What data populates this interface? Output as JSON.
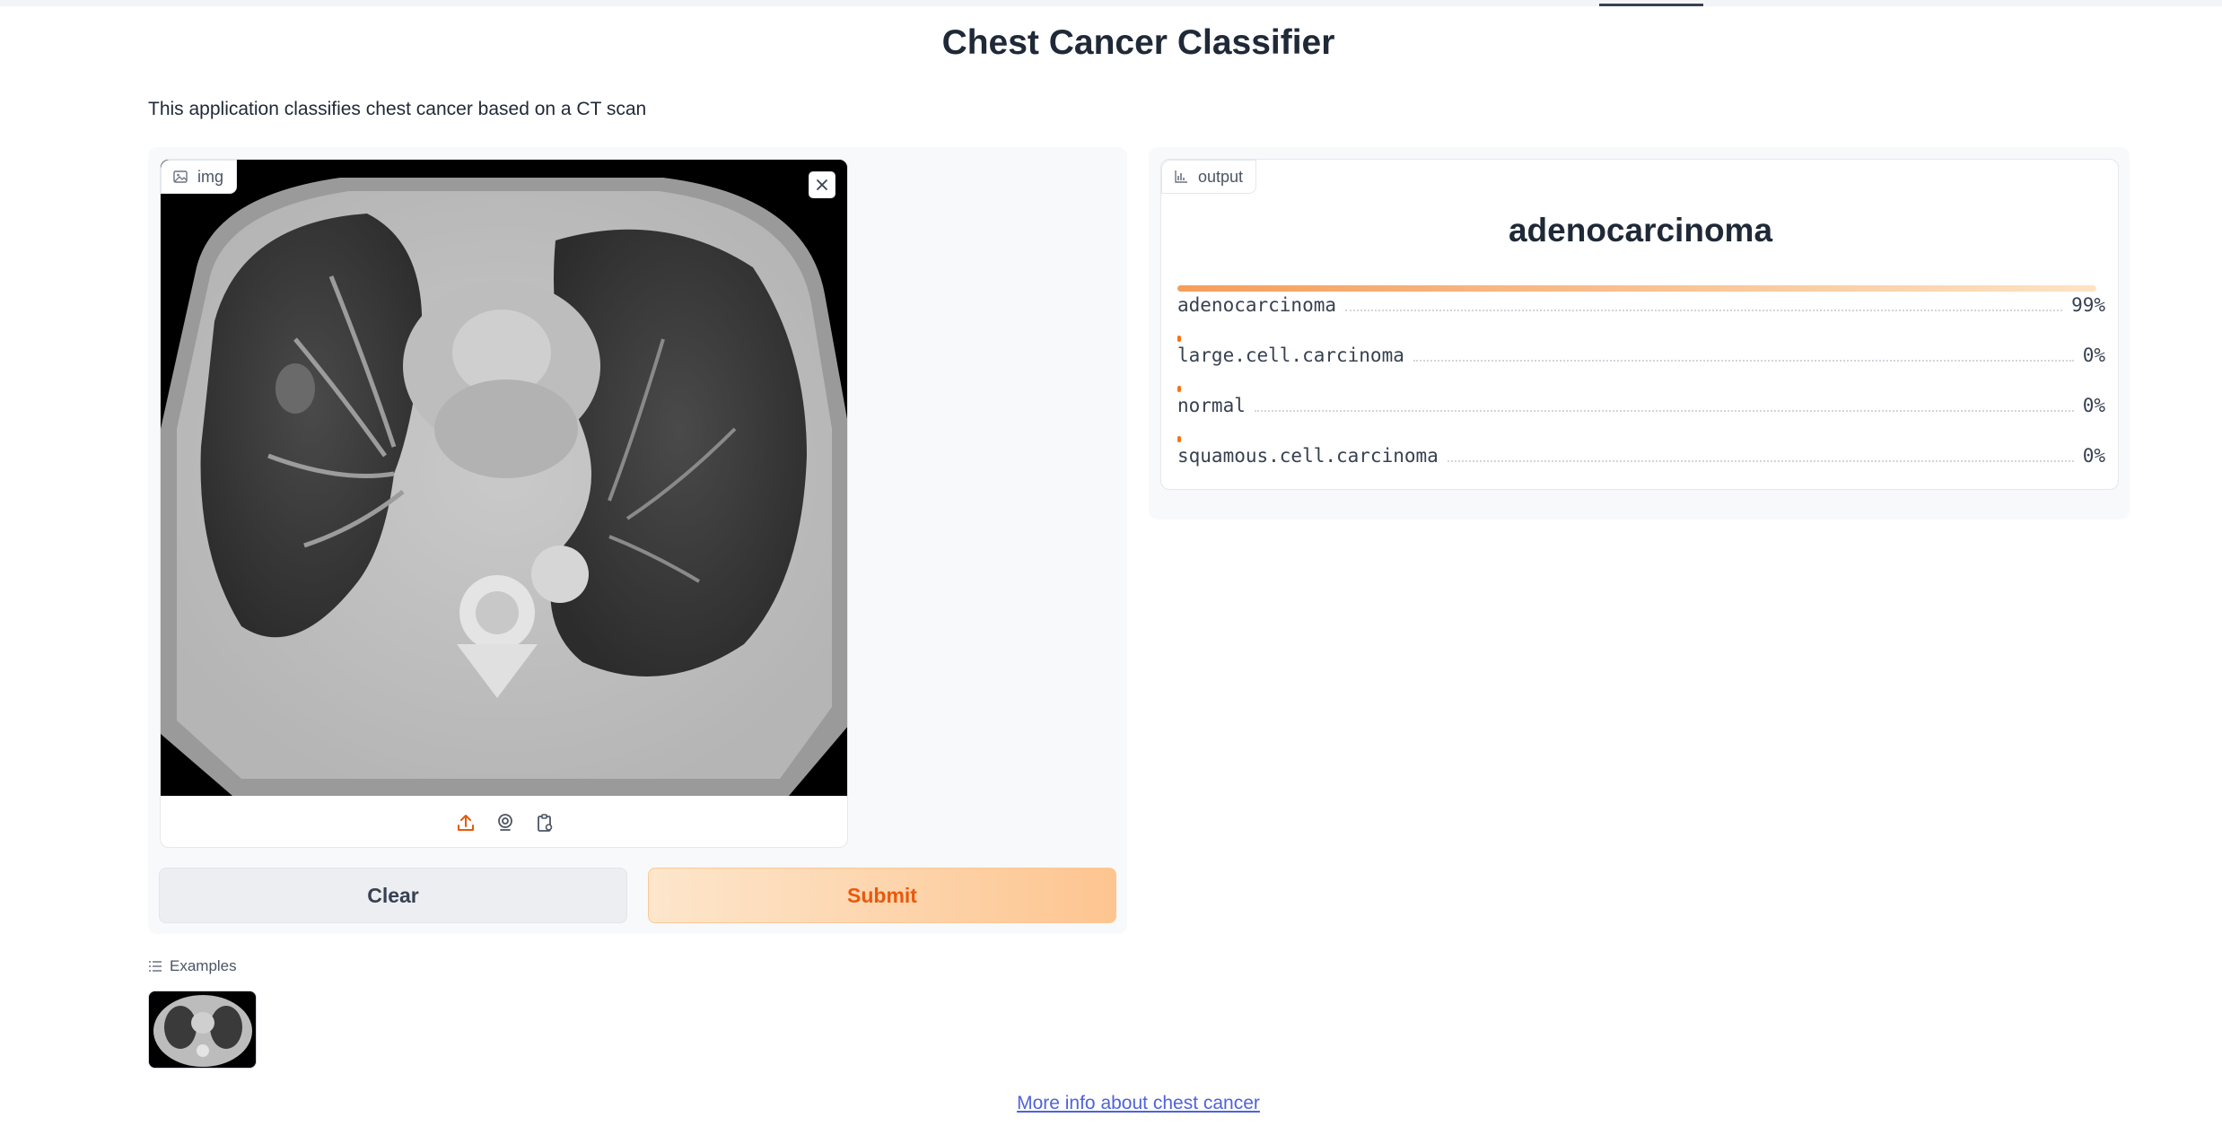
{
  "app": {
    "title": "Chest Cancer Classifier",
    "description": "This application classifies chest cancer based on a CT scan"
  },
  "input": {
    "label": "img",
    "label_icon": "image-icon",
    "source_icons": [
      "upload-icon",
      "webcam-icon",
      "clipboard-icon"
    ],
    "active_source_color": "#ea580c"
  },
  "buttons": {
    "clear_label": "Clear",
    "submit_label": "Submit"
  },
  "output": {
    "label": "output",
    "label_icon": "bar-chart-icon",
    "predicted": "adenocarcinoma",
    "confidences": [
      {
        "label": "adenocarcinoma",
        "percent_text": "99%",
        "fraction": 0.99
      },
      {
        "label": "large.cell.carcinoma",
        "percent_text": "0%",
        "fraction": 0.0
      },
      {
        "label": "normal",
        "percent_text": "0%",
        "fraction": 0.0
      },
      {
        "label": "squamous.cell.carcinoma",
        "percent_text": "0%",
        "fraction": 0.0
      }
    ]
  },
  "examples": {
    "label": "Examples"
  },
  "footer": {
    "link_text": "More info about chest cancer"
  },
  "colors": {
    "accent": "#f97316",
    "submit_text": "#ea580c",
    "link": "#4f63d8"
  }
}
